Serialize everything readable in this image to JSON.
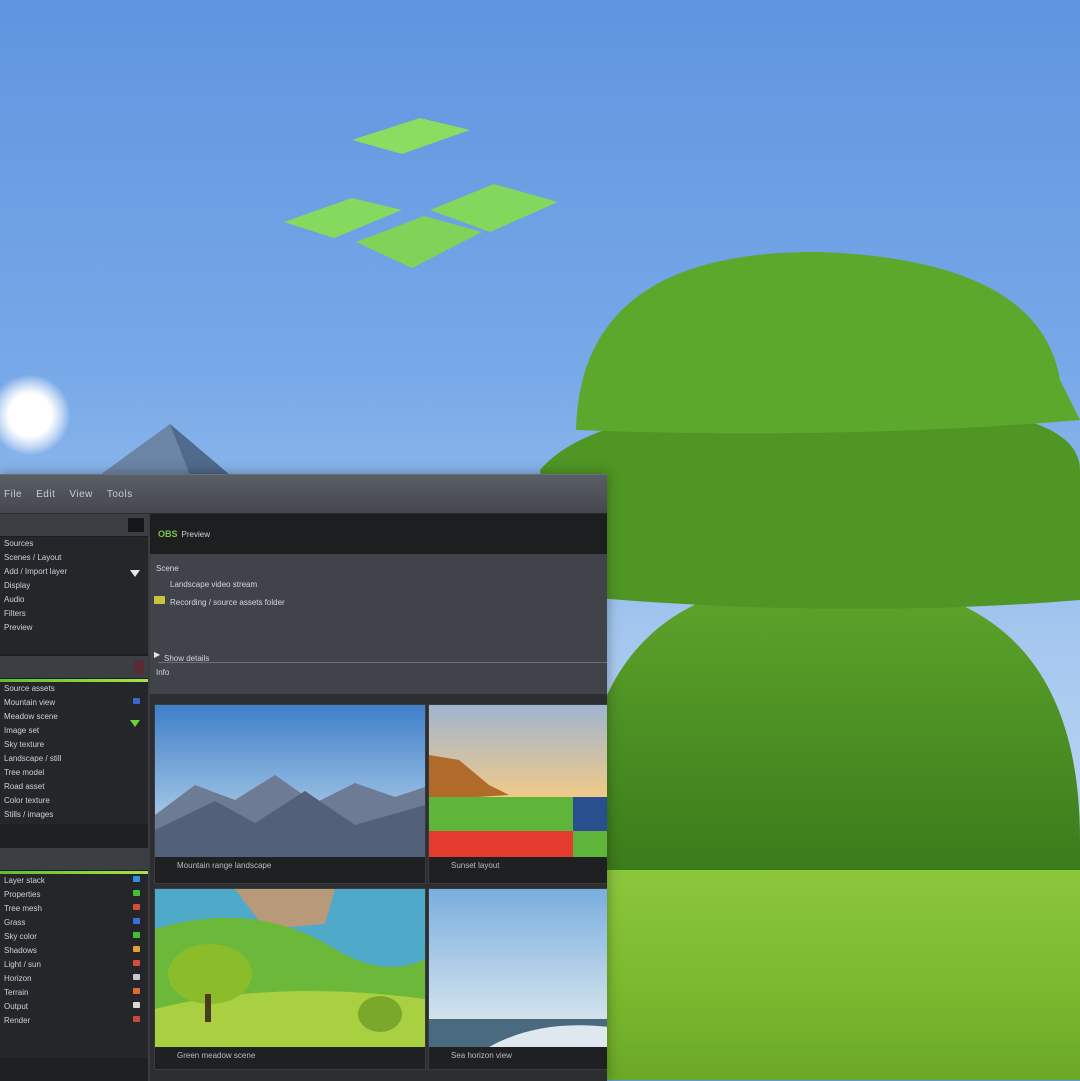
{
  "colors": {
    "accent_green": "#7ec34a",
    "window_bg": "#2b2d30",
    "status_red": "#e43b2f",
    "status_blue": "#2a4f8f"
  },
  "menubar": {
    "items": [
      "File",
      "Edit",
      "View",
      "Tools"
    ]
  },
  "sidebar": {
    "top_panel_rows": [
      "Sources",
      "Scenes / Layout",
      "Add / Import layer",
      "Display",
      "Audio",
      "Filters",
      "Preview"
    ],
    "mid_panel_rows": [
      "Source assets",
      "Mountain view",
      "Meadow scene",
      "Image set",
      "Sky texture",
      "Landscape / still",
      "Tree model",
      "Road asset",
      "Color texture",
      "Stills / images"
    ],
    "bottom_panel_rows": [
      "Layer stack",
      "Properties",
      "Tree mesh",
      "Grass",
      "Sky color",
      "Shadows",
      "Light / sun",
      "Horizon",
      "Terrain",
      "Output",
      "Render"
    ]
  },
  "main": {
    "brand": "OBS",
    "title": "Preview",
    "info_lines": [
      "Scene",
      "Landscape video stream",
      "Recording / source assets folder"
    ],
    "footer_label": "Show details",
    "footer_sub": "Info"
  },
  "thumbnails": [
    {
      "caption": "Mountain range landscape"
    },
    {
      "caption": "Sunset layout"
    },
    {
      "caption": "Green meadow scene"
    },
    {
      "caption": "Sea horizon view"
    }
  ],
  "icons": [
    "window-logo-icon",
    "folder-icon",
    "chevron-down-icon",
    "play-icon"
  ]
}
